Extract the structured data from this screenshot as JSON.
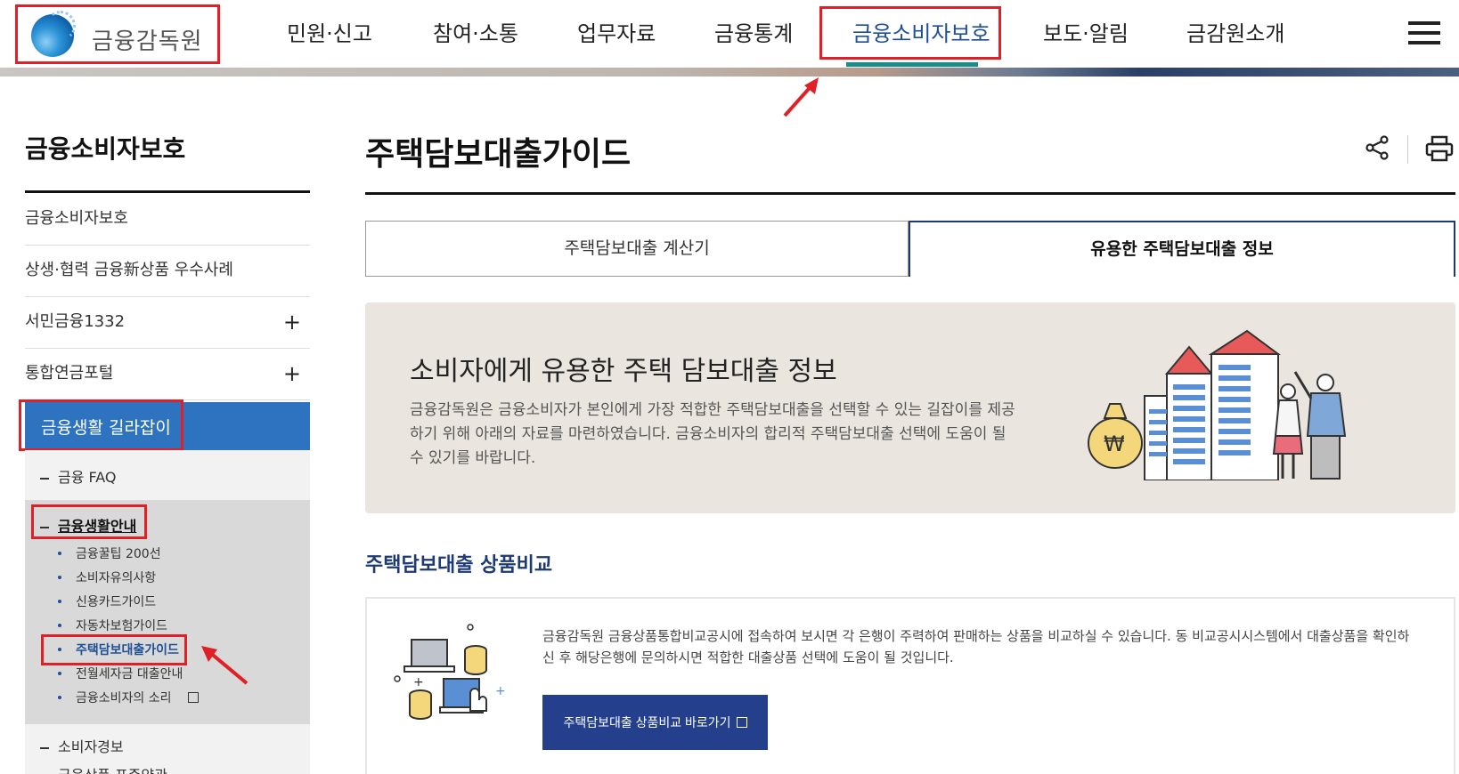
{
  "header": {
    "logo_text": "금융감독원",
    "nav": [
      "민원·신고",
      "참여·소통",
      "업무자료",
      "금융통계",
      "금융소비자보호",
      "보도·알림",
      "금감원소개"
    ],
    "active_nav": "금융소비자보호"
  },
  "sidebar": {
    "title": "금융소비자보호",
    "items": [
      {
        "label": "금융소비자보호",
        "expand": ""
      },
      {
        "label": "상생·협력 금융新상품 우수사례",
        "expand": ""
      },
      {
        "label": "서민금융1332",
        "expand": "+"
      },
      {
        "label": "통합연금포털",
        "expand": "+"
      }
    ],
    "active": "금융생활 길라잡이",
    "sub": {
      "faq": "금융 FAQ",
      "guide": "금융생활안내",
      "leaves": [
        "금융꿀팁 200선",
        "소비자유의사항",
        "신용카드가이드",
        "자동차보험가이드",
        "주택담보대출가이드",
        "전월세자금 대출안내",
        "금융소비자의 소리"
      ],
      "alert": "소비자경보",
      "cut_item": "금융상품 표준약관"
    }
  },
  "main": {
    "title": "주택담보대출가이드",
    "tabs": [
      "주택담보대출 계산기",
      "유용한 주택담보대출 정보"
    ],
    "banner_title": "소비자에게 유용한 주택 담보대출 정보",
    "banner_desc": "금융감독원은 금융소비자가 본인에게 가장 적합한 주택담보대출을 선택할 수 있는 길잡이를 제공하기 위해 아래의 자료를 마련하였습니다. 금융소비자의 합리적 주택담보대출 선택에 도움이 될 수 있기를 바랍니다.",
    "section_title": "주택담보대출 상품비교",
    "info_text": "금융감독원 금융상품통합비교공시에 접속하여 보시면 각 은행이 주력하여 판매하는 상품을 비교하실 수 있습니다. 동 비교공시시스템에서 대출상품을 확인하신 후 해당은행에 문의하시면 적합한 대출상품 선택에 도움이 될 것입니다.",
    "button_label": "주택담보대출 상품비교 바로가기",
    "money_symbol": "₩"
  },
  "colors": {
    "accent": "#1e4f97",
    "highlight": "#e01f26",
    "active_bg": "#2e73c0",
    "button": "#243f8c"
  }
}
